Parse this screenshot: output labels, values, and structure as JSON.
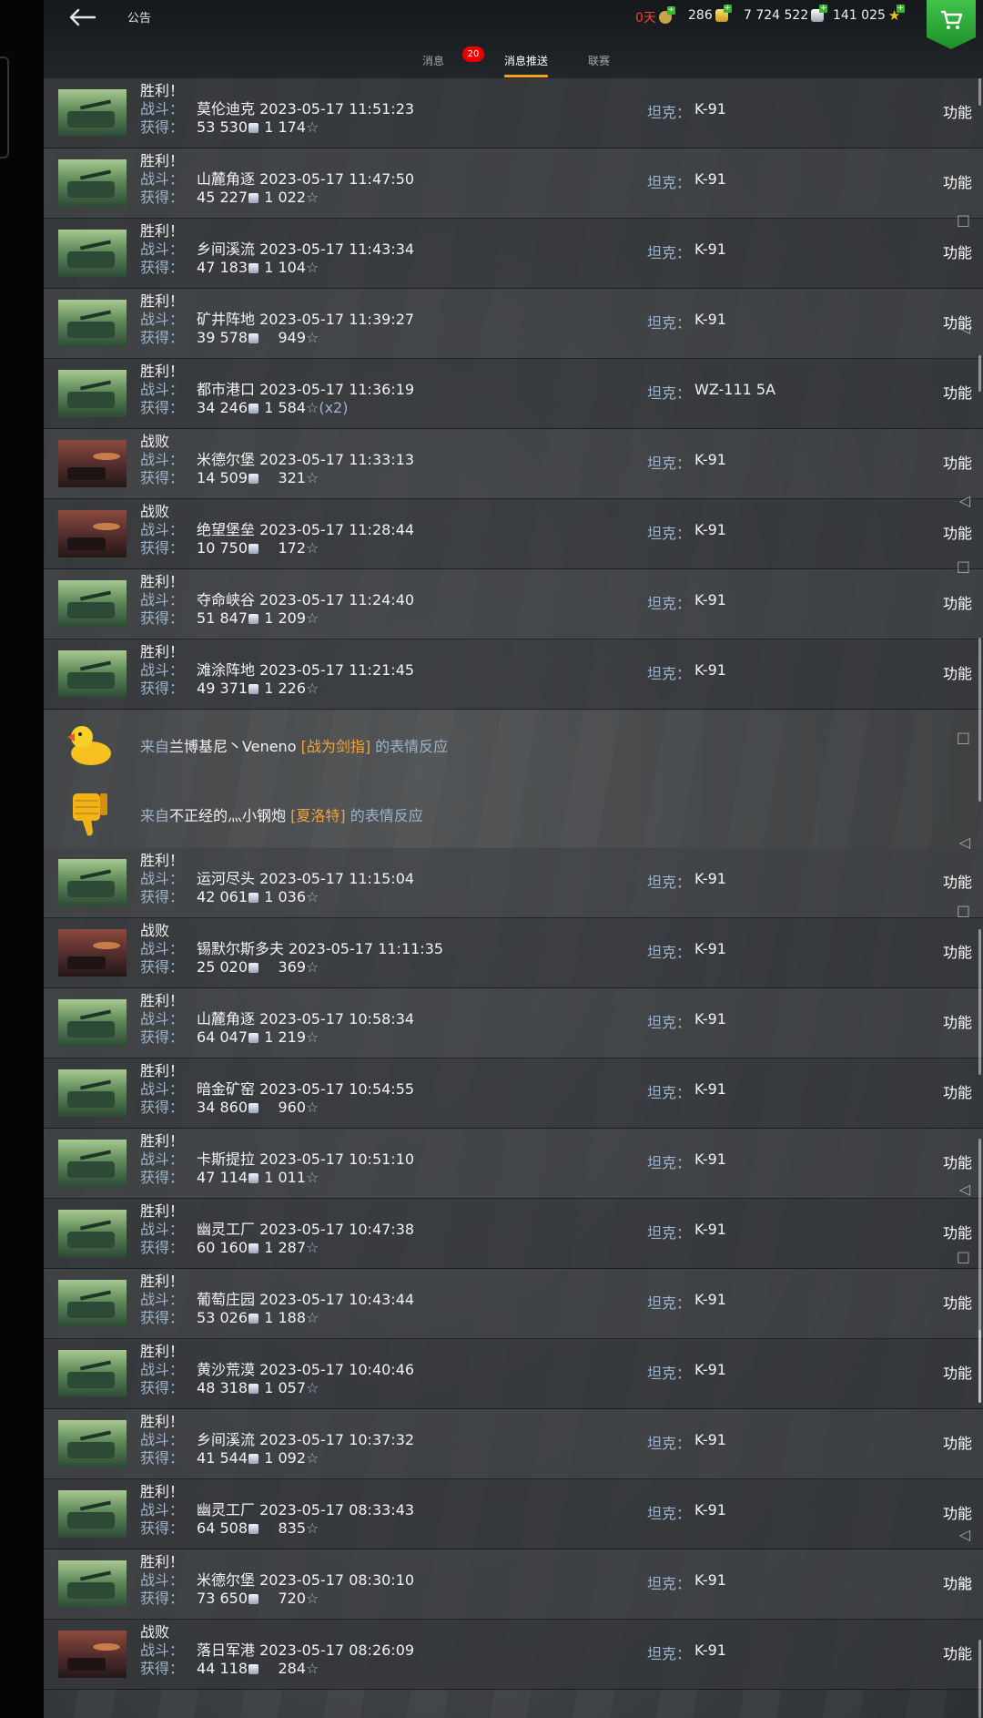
{
  "header": {
    "title": "公告",
    "resources": {
      "days": "0天",
      "gold": "286",
      "silver": "7 724 522",
      "free_xp": "141 025"
    },
    "tabs": [
      "消息",
      "消息推送",
      "联赛"
    ],
    "badge": "20",
    "active_tab": "消息推送"
  },
  "labels": {
    "battle": "战斗：",
    "earned": "获得：",
    "tank": "坦克：",
    "function": "功能",
    "from": "来自",
    "reaction": "的表情反应"
  },
  "items": [
    {
      "type": "battle",
      "result": "胜利！",
      "outcome": "win",
      "map": "莫伦迪克",
      "datetime": "2023-05-17 11:51:23",
      "credits": "53 530",
      "xp": "1 174",
      "tank": "K-91"
    },
    {
      "type": "battle",
      "result": "胜利！",
      "outcome": "win",
      "map": "山麓角逐",
      "datetime": "2023-05-17 11:47:50",
      "credits": "45 227",
      "xp": "1 022",
      "tank": "K-91"
    },
    {
      "type": "battle",
      "result": "胜利！",
      "outcome": "win",
      "map": "乡间溪流",
      "datetime": "2023-05-17 11:43:34",
      "credits": "47 183",
      "xp": "1 104",
      "tank": "K-91"
    },
    {
      "type": "battle",
      "result": "胜利！",
      "outcome": "win",
      "map": "矿井阵地",
      "datetime": "2023-05-17 11:39:27",
      "credits": "39 578",
      "xp": "949",
      "tank": "K-91"
    },
    {
      "type": "battle",
      "result": "胜利！",
      "outcome": "win",
      "map": "都市港口",
      "datetime": "2023-05-17 11:36:19",
      "credits": "34 246",
      "xp": "1 584",
      "multiplier": "(x2)",
      "tank": "WZ-111 5A"
    },
    {
      "type": "battle",
      "result": "战败",
      "outcome": "loss",
      "map": "米德尔堡",
      "datetime": "2023-05-17 11:33:13",
      "credits": "14 509",
      "xp": "321",
      "tank": "K-91"
    },
    {
      "type": "battle",
      "result": "战败",
      "outcome": "loss",
      "map": "绝望堡垒",
      "datetime": "2023-05-17 11:28:44",
      "credits": "10 750",
      "xp": "172",
      "tank": "K-91"
    },
    {
      "type": "battle",
      "result": "胜利！",
      "outcome": "win",
      "map": "夺命峡谷",
      "datetime": "2023-05-17 11:24:40",
      "credits": "51 847",
      "xp": "1 209",
      "tank": "K-91"
    },
    {
      "type": "battle",
      "result": "胜利！",
      "outcome": "win",
      "map": "滩涂阵地",
      "datetime": "2023-05-17 11:21:45",
      "credits": "49 371",
      "xp": "1 226",
      "tank": "K-91"
    },
    {
      "type": "reaction",
      "icon": "duck",
      "player": "兰博基尼丶Veneno",
      "clan": "[战为剑指]"
    },
    {
      "type": "reaction",
      "icon": "thumbs-down",
      "player": "不正经的灬小钢炮",
      "clan": "[夏洛特]"
    },
    {
      "type": "battle",
      "result": "胜利！",
      "outcome": "win",
      "map": "运河尽头",
      "datetime": "2023-05-17 11:15:04",
      "credits": "42 061",
      "xp": "1 036",
      "tank": "K-91"
    },
    {
      "type": "battle",
      "result": "战败",
      "outcome": "loss",
      "map": "锡默尔斯多夫",
      "datetime": "2023-05-17 11:11:35",
      "credits": "25 020",
      "xp": "369",
      "tank": "K-91"
    },
    {
      "type": "battle",
      "result": "胜利！",
      "outcome": "win",
      "map": "山麓角逐",
      "datetime": "2023-05-17 10:58:34",
      "credits": "64 047",
      "xp": "1 219",
      "tank": "K-91"
    },
    {
      "type": "battle",
      "result": "胜利！",
      "outcome": "win",
      "map": "暗金矿窑",
      "datetime": "2023-05-17 10:54:55",
      "credits": "34 860",
      "xp": "960",
      "tank": "K-91"
    },
    {
      "type": "battle",
      "result": "胜利！",
      "outcome": "win",
      "map": "卡斯提拉",
      "datetime": "2023-05-17 10:51:10",
      "credits": "47 114",
      "xp": "1 011",
      "tank": "K-91"
    },
    {
      "type": "battle",
      "result": "胜利！",
      "outcome": "win",
      "map": "幽灵工厂",
      "datetime": "2023-05-17 10:47:38",
      "credits": "60 160",
      "xp": "1 287",
      "tank": "K-91"
    },
    {
      "type": "battle",
      "result": "胜利！",
      "outcome": "win",
      "map": "葡萄庄园",
      "datetime": "2023-05-17 10:43:44",
      "credits": "53 026",
      "xp": "1 188",
      "tank": "K-91"
    },
    {
      "type": "battle",
      "result": "胜利！",
      "outcome": "win",
      "map": "黄沙荒漠",
      "datetime": "2023-05-17 10:40:46",
      "credits": "48 318",
      "xp": "1 057",
      "tank": "K-91"
    },
    {
      "type": "battle",
      "result": "胜利！",
      "outcome": "win",
      "map": "乡间溪流",
      "datetime": "2023-05-17 10:37:32",
      "credits": "41 544",
      "xp": "1 092",
      "tank": "K-91"
    },
    {
      "type": "battle",
      "result": "胜利！",
      "outcome": "win",
      "map": "幽灵工厂",
      "datetime": "2023-05-17 08:33:43",
      "credits": "64 508",
      "xp": "835",
      "tank": "K-91"
    },
    {
      "type": "battle",
      "result": "胜利！",
      "outcome": "win",
      "map": "米德尔堡",
      "datetime": "2023-05-17 08:30:10",
      "credits": "73 650",
      "xp": "720",
      "tank": "K-91"
    },
    {
      "type": "battle",
      "result": "战败",
      "outcome": "loss",
      "map": "落日军港",
      "datetime": "2023-05-17 08:26:09",
      "credits": "44 118",
      "xp": "284",
      "tank": "K-91"
    }
  ],
  "colors": {
    "label_blue": "#9db4cc",
    "clan_orange": "#f0a33c",
    "days_red": "#ff3b2f",
    "tab_underline": "#f2a21a",
    "badge_red": "#e00000",
    "cart_green": "#2fae3a"
  }
}
